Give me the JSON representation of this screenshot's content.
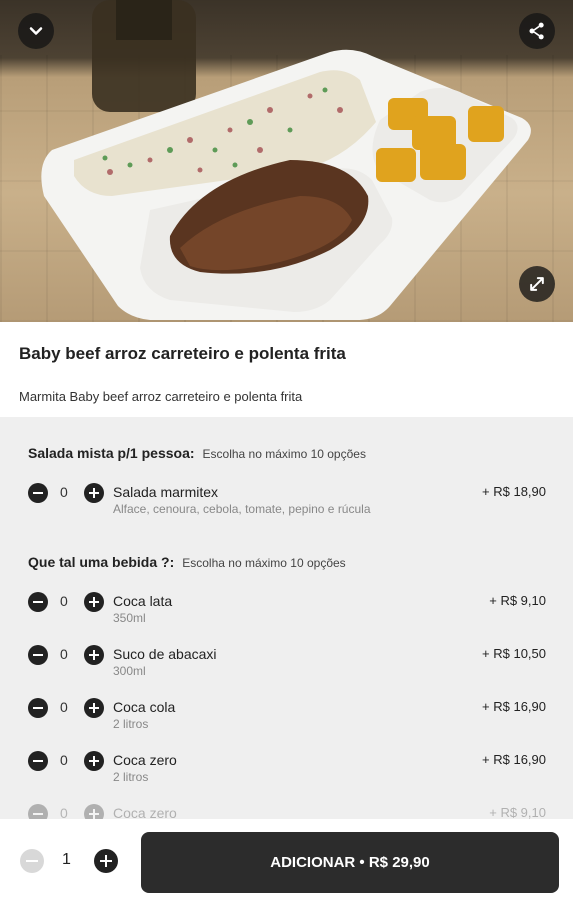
{
  "product": {
    "title": "Baby beef arroz carreteiro e polenta frita",
    "description": "Marmita Baby beef arroz carreteiro e polenta frita"
  },
  "icons": {
    "back": "chevron-down-icon",
    "share": "share-icon",
    "expand": "expand-icon"
  },
  "groups": [
    {
      "title": "Salada mista p/1 pessoa:",
      "hint": "Escolha no máximo 10 opções",
      "options": [
        {
          "name": "Salada marmitex",
          "subtitle": "Alface, cenoura, cebola, tomate, pepino e rúcula",
          "qty": "0",
          "price": "+ R$ 18,90"
        }
      ]
    },
    {
      "title": "Que tal uma bebida ?:",
      "hint": "Escolha no máximo 10 opções",
      "options": [
        {
          "name": "Coca lata",
          "subtitle": "350ml",
          "qty": "0",
          "price": "+ R$ 9,10"
        },
        {
          "name": "Suco de abacaxi",
          "subtitle": "300ml",
          "qty": "0",
          "price": "+ R$ 10,50"
        },
        {
          "name": "Coca cola",
          "subtitle": "2 litros",
          "qty": "0",
          "price": "+ R$ 16,90"
        },
        {
          "name": "Coca zero",
          "subtitle": "2 litros",
          "qty": "0",
          "price": "+ R$ 16,90"
        },
        {
          "name": "Coca zero",
          "subtitle": "",
          "qty": "0",
          "price": "+ R$ 9,10"
        }
      ]
    }
  ],
  "footer": {
    "quantity": "1",
    "add_label": "ADICIONAR • R$ 29,90"
  }
}
